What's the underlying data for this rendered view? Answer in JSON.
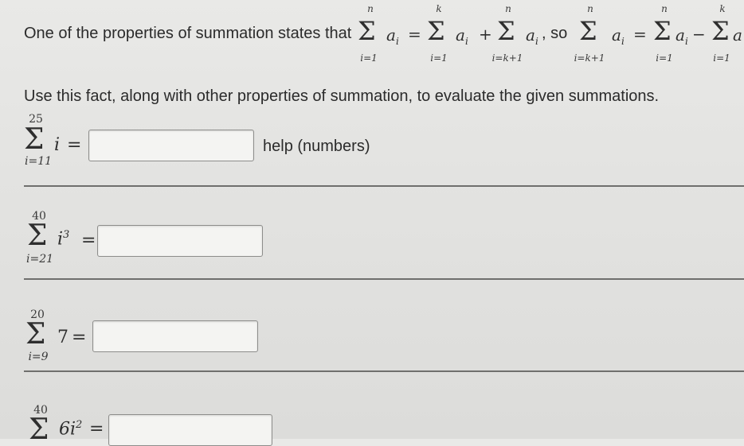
{
  "header": {
    "intro": "One of the properties of summation states that",
    "term_a": "a",
    "sub_i": "i",
    "top_n": "n",
    "top_k": "k",
    "bot_i1": "i=1",
    "bot_ik1": "i=k+1",
    "plus": "+",
    "minus": "−",
    "equals": "=",
    "so": ", so"
  },
  "instruction": "Use this fact, along with other properties of summation, to evaluate the given summations.",
  "help_label": "help (numbers)",
  "problems": [
    {
      "upper": "25",
      "lower": "i=11",
      "term": "i",
      "exp": "",
      "answer": ""
    },
    {
      "upper": "40",
      "lower": "i=21",
      "term": "i",
      "exp": "3",
      "answer": ""
    },
    {
      "upper": "20",
      "lower": "i=9",
      "term": "7",
      "exp": "",
      "answer": ""
    },
    {
      "upper": "40",
      "lower": "",
      "term": "6i",
      "exp": "2",
      "answer": ""
    }
  ]
}
